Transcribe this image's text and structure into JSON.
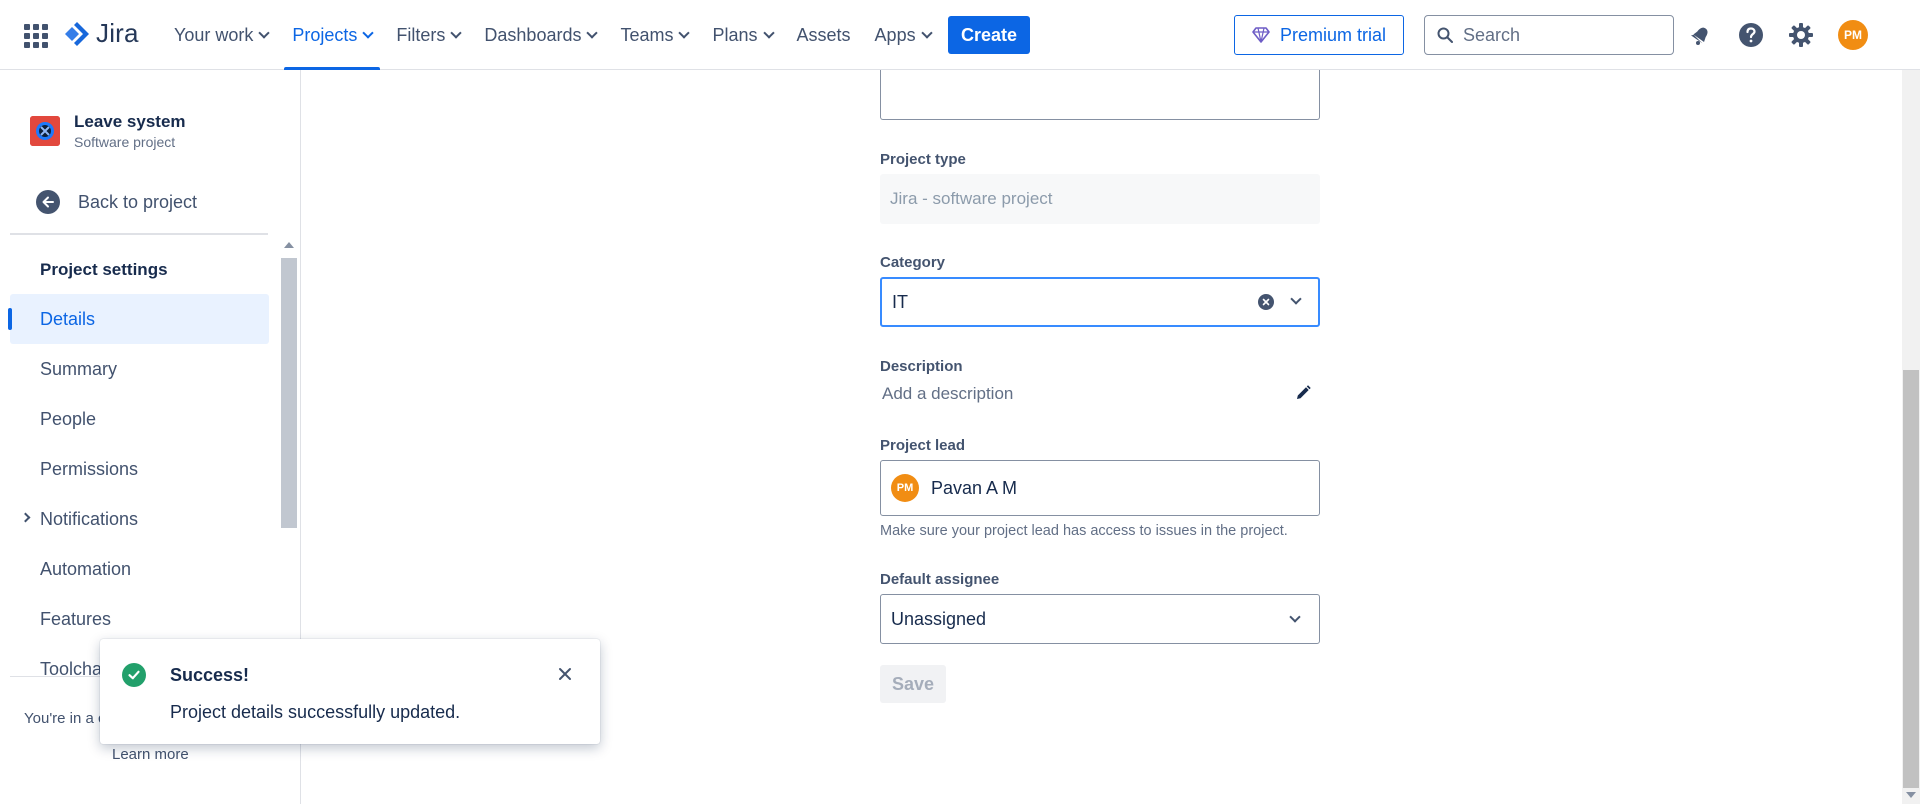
{
  "topnav": {
    "brand": "Jira",
    "items": [
      {
        "label": "Your work",
        "dropdown": true,
        "active": false
      },
      {
        "label": "Projects",
        "dropdown": true,
        "active": true
      },
      {
        "label": "Filters",
        "dropdown": true,
        "active": false
      },
      {
        "label": "Dashboards",
        "dropdown": true,
        "active": false
      },
      {
        "label": "Teams",
        "dropdown": true,
        "active": false
      },
      {
        "label": "Plans",
        "dropdown": true,
        "active": false
      },
      {
        "label": "Assets",
        "dropdown": false,
        "active": false
      },
      {
        "label": "Apps",
        "dropdown": true,
        "active": false
      }
    ],
    "create_label": "Create",
    "premium_label": "Premium trial",
    "search_placeholder": "Search",
    "user_initials": "PM",
    "accent_color": "#0c66e4"
  },
  "sidebar": {
    "project_name": "Leave system",
    "project_type": "Software project",
    "back_label": "Back to project",
    "section_title": "Project settings",
    "items": [
      {
        "label": "Details",
        "active": true
      },
      {
        "label": "Summary"
      },
      {
        "label": "People"
      },
      {
        "label": "Permissions"
      },
      {
        "label": "Notifications",
        "expandable": true
      },
      {
        "label": "Automation"
      },
      {
        "label": "Features"
      },
      {
        "label": "Toolcha"
      }
    ],
    "notice_text": "You're in a c",
    "learn_more": "Learn more"
  },
  "form": {
    "project_type_label": "Project type",
    "project_type_value": "Jira - software project",
    "category_label": "Category",
    "category_value": "IT",
    "description_label": "Description",
    "description_placeholder": "Add a description",
    "project_lead_label": "Project lead",
    "project_lead_name": "Pavan A M",
    "project_lead_initials": "PM",
    "project_lead_help": "Make sure your project lead has access to issues in the project.",
    "default_assignee_label": "Default assignee",
    "default_assignee_value": "Unassigned",
    "save_label": "Save"
  },
  "toast": {
    "title": "Success!",
    "message": "Project details successfully updated.",
    "status_color": "#22a06b"
  }
}
